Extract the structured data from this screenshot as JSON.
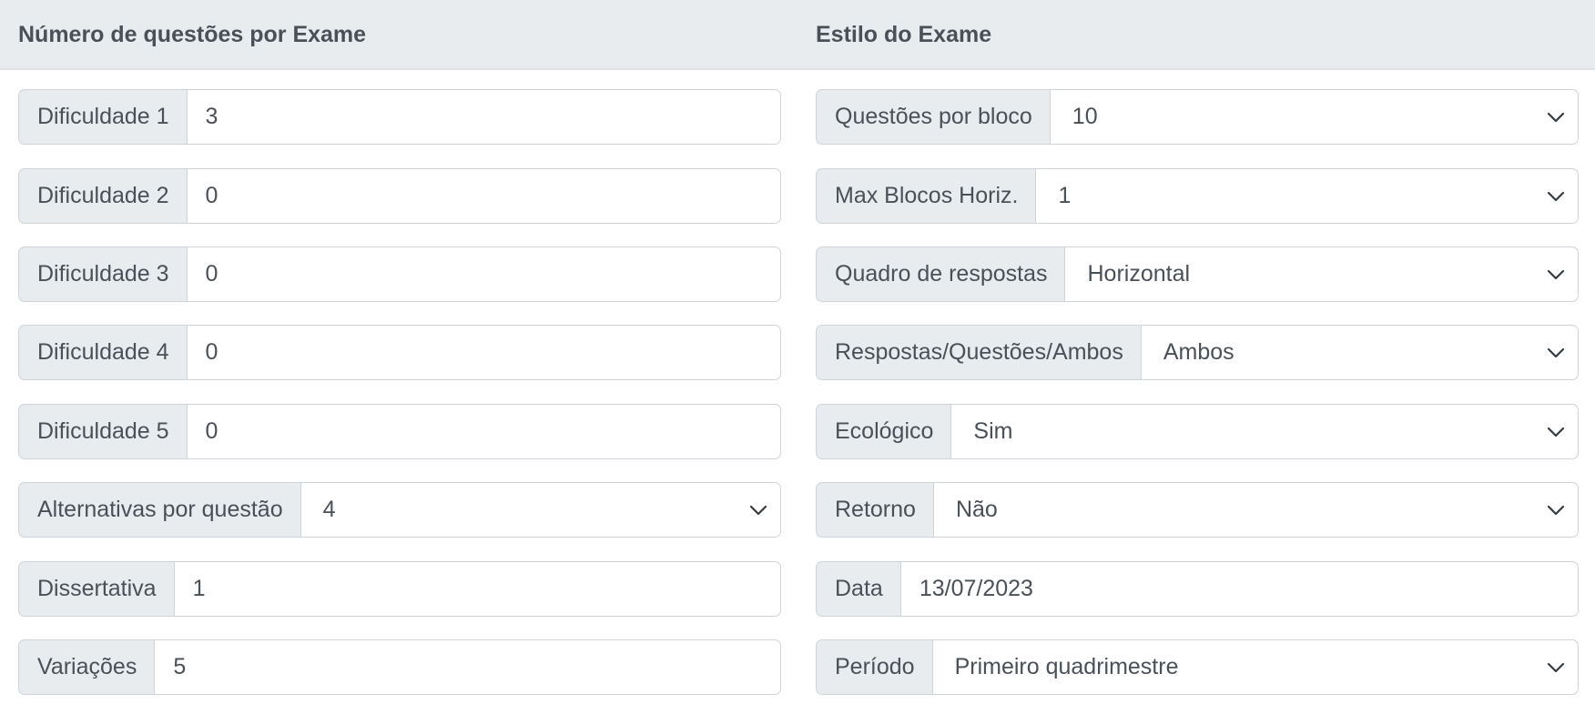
{
  "left": {
    "title": "Número de questões por Exame",
    "rows": [
      {
        "label": "Dificuldade 1",
        "value": "3"
      },
      {
        "label": "Dificuldade 2",
        "value": "0"
      },
      {
        "label": "Dificuldade 3",
        "value": "0"
      },
      {
        "label": "Dificuldade 4",
        "value": "0"
      },
      {
        "label": "Dificuldade 5",
        "value": "0"
      },
      {
        "label": "Alternativas por questão",
        "value": "4"
      },
      {
        "label": "Dissertativa",
        "value": "1"
      },
      {
        "label": "Variações",
        "value": "5"
      }
    ]
  },
  "right": {
    "title": "Estilo do Exame",
    "rows": [
      {
        "label": "Questões por bloco",
        "value": "10"
      },
      {
        "label": "Max Blocos Horiz.",
        "value": "1"
      },
      {
        "label": "Quadro de respostas",
        "value": "Horizontal"
      },
      {
        "label": "Respostas/Questões/Ambos",
        "value": "Ambos"
      },
      {
        "label": "Ecológico",
        "value": "Sim"
      },
      {
        "label": "Retorno",
        "value": "Não"
      },
      {
        "label": "Data",
        "value": "13/07/2023"
      },
      {
        "label": "Período",
        "value": "Primeiro quadrimestre"
      }
    ]
  },
  "icons": {
    "select_arrow": "chevron-down-icon"
  }
}
